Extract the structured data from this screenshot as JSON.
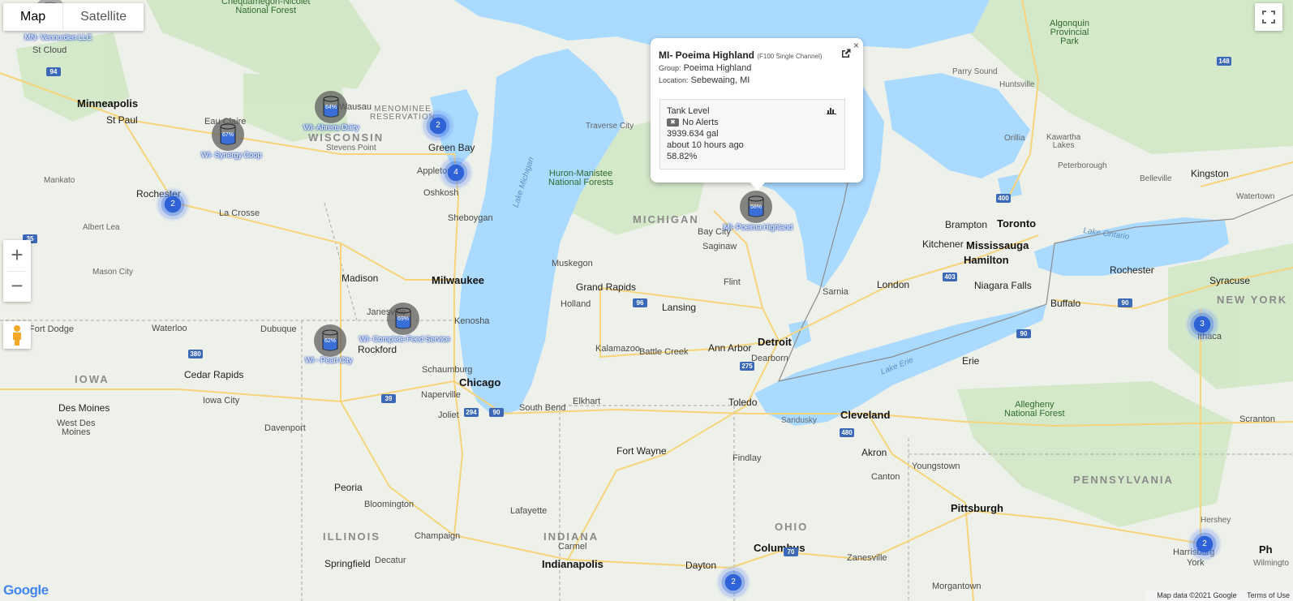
{
  "map_type": {
    "map_label": "Map",
    "satellite_label": "Satellite"
  },
  "controls": {
    "zoom_in": "+",
    "zoom_out": "−"
  },
  "footer": {
    "map_data": "Map data ©2021 Google",
    "terms": "Terms of Use",
    "logo": "Google"
  },
  "colors": {
    "water": "#aadaff",
    "land": "#eef0ea",
    "forest": "#cfe6c4",
    "cluster": "#2e62d6",
    "tank_fill": "#3a6fd8"
  },
  "states": {
    "wisconsin": "WISCONSIN",
    "michigan": "MICHIGAN",
    "iowa": "IOWA",
    "illinois": "ILLINOIS",
    "indiana": "INDIANA",
    "ohio": "OHIO",
    "new_york": "NEW YORK",
    "pennsylvania": "PENNSYLVANIA"
  },
  "water_labels": {
    "lake_michigan": "Lake Michigan",
    "lake_ontario": "Lake Ontario",
    "lake_erie": "Lake Erie"
  },
  "parks": {
    "chequamegon": "Chequamegon-Nicolet\nNational Forest",
    "huron_manistee": "Huron-Manistee\nNational Forests",
    "menominee": "MENOMINEE\nRESERVATION",
    "algonquin": "Algonquin\nProvincial\nPark",
    "allegheny": "Allegheny\nNational Forest"
  },
  "cities": {
    "minneapolis": "Minneapolis",
    "st_paul": "St Paul",
    "st_cloud": "St Cloud",
    "eau_claire": "Eau Claire",
    "rochester_mn": "Rochester",
    "la_crosse": "La Crosse",
    "mankato": "Mankato",
    "albert_lea": "Albert Lea",
    "mason_city": "Mason City",
    "wausau": "Wausau",
    "stevens_point": "Stevens Point",
    "green_bay": "Green Bay",
    "appleton": "Appleton",
    "oshkosh": "Oshkosh",
    "sheboygan": "Sheboygan",
    "madison": "Madison",
    "milwaukee": "Milwaukee",
    "janesville": "Janesville",
    "kenosha": "Kenosha",
    "rockford": "Rockford",
    "dubuque": "Dubuque",
    "waterloo": "Waterloo",
    "cedar_rapids": "Cedar Rapids",
    "iowa_city": "Iowa City",
    "des_moines": "Des Moines",
    "west_des_moines": "West Des\nMoines",
    "davenport": "Davenport",
    "fort_dodge": "Fort Dodge",
    "schaumburg": "Schaumburg",
    "chicago": "Chicago",
    "naperville": "Naperville",
    "joliet": "Joliet",
    "peoria": "Peoria",
    "bloomington": "Bloomington",
    "champaign": "Champaign",
    "springfield": "Springfield",
    "decatur": "Decatur",
    "south_bend": "South Bend",
    "elkhart": "Elkhart",
    "fort_wayne": "Fort Wayne",
    "lafayette": "Lafayette",
    "carmel": "Carmel",
    "indianapolis": "Indianapolis",
    "grand_rapids": "Grand Rapids",
    "muskegon": "Muskegon",
    "holland": "Holland",
    "kalamazoo": "Kalamazoo",
    "battle_creek": "Battle Creek",
    "lansing": "Lansing",
    "ann_arbor": "Ann Arbor",
    "dearborn": "Dearborn",
    "detroit": "Detroit",
    "flint": "Flint",
    "saginaw": "Saginaw",
    "bay_city": "Bay City",
    "traverse_city": "Traverse City",
    "sarnia": "Sarnia",
    "london": "London",
    "toledo": "Toledo",
    "sandusky": "Sandusky",
    "cleveland": "Cleveland",
    "akron": "Akron",
    "canton": "Canton",
    "youngstown": "Youngstown",
    "findlay": "Findlay",
    "dayton": "Dayton",
    "columbus": "Columbus",
    "zanesville": "Zanesville",
    "pittsburgh": "Pittsburgh",
    "morgantown": "Morgantown",
    "erie": "Erie",
    "buffalo": "Buffalo",
    "niagara_falls": "Niagara Falls",
    "hamilton": "Hamilton",
    "mississauga": "Mississauga",
    "toronto": "Toronto",
    "brampton": "Brampton",
    "kitchener": "Kitchener",
    "rochester_ny": "Rochester",
    "syracuse": "Syracuse",
    "ithaca": "Ithaca",
    "scranton": "Scranton",
    "harrisburg": "Harrisburg",
    "york": "York",
    "hershey": "Hershey",
    "kingston": "Kingston",
    "belleville": "Belleville",
    "peterborough": "Peterborough",
    "kawartha": "Kawartha\nLakes",
    "orillia": "Orillia",
    "huntsville": "Huntsville",
    "parry_sound": "Parry Sound",
    "watertown": "Watertown",
    "wilmington": "Wilmingto",
    "ph": "Ph"
  },
  "tanks": [
    {
      "name": "WI- Ahrens Dairy",
      "pct": "64%",
      "fill": 0.64
    },
    {
      "name": "WI- Synergy Coop",
      "pct": "67%",
      "fill": 0.67
    },
    {
      "name": "WI- Complete Feed Service",
      "pct": "69%",
      "fill": 0.69
    },
    {
      "name": "WI - Pearl City",
      "pct": "62%",
      "fill": 0.62
    },
    {
      "name": "MI- Poeima Highland",
      "pct": "58%",
      "fill": 0.58
    },
    {
      "name": "MN- Vennurden LLC",
      "pct": "",
      "fill": 0.6
    }
  ],
  "clusters": [
    "2",
    "4",
    "2",
    "3",
    "2",
    "2"
  ],
  "info_window": {
    "title": "MI- Poeima Highland",
    "device": "(F100 Single Channel)",
    "group_key": "Group:",
    "group": "Poeima Highland",
    "location_key": "Location:",
    "location": "Sebewaing, MI",
    "card_title": "Tank Level",
    "alert_badge": "✖",
    "alerts": "No Alerts",
    "volume": "3939.634 gal",
    "updated": "about 10 hours ago",
    "percent": "58.82%",
    "close": "×"
  }
}
